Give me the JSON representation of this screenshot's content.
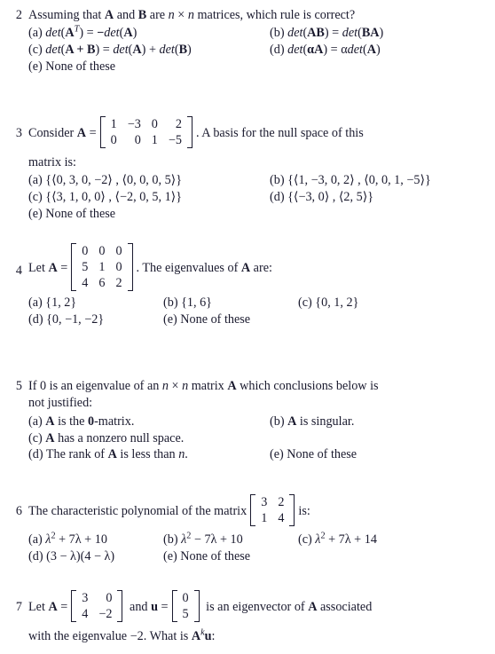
{
  "document": {
    "type": "linear-algebra-multiple-choice-exam",
    "background_color": "#ffffff",
    "text_color": "#1a1a2e"
  },
  "questions": [
    {
      "number": "2",
      "stem_parts": {
        "p1": "Assuming that ",
        "A": "A",
        "p2": " and ",
        "B": "B",
        "p3": " are ",
        "n1": "n",
        "times": " × ",
        "n2": "n",
        "p4": " matrices, which rule is correct?"
      },
      "options": {
        "a_label": "(a)",
        "a_det1": "det",
        "a_open": "(",
        "a_A": "A",
        "a_T": "T",
        "a_close": ")",
        "a_eq": " = ",
        "a_minus": "−",
        "a_det2": "det",
        "a_A2": "A",
        "b_label": "(b)",
        "b_det1": "det",
        "b_AB": "AB",
        "b_eq": " = ",
        "b_det2": "det",
        "b_BA": "BA",
        "c_label": "(c)",
        "c_det1": "det",
        "c_ApB": "A + B",
        "c_eq": " = ",
        "c_det2": "det",
        "c_A": "A",
        "c_plus": " + ",
        "c_det3": "det",
        "c_B": "B",
        "d_label": "(d)",
        "d_det1": "det",
        "d_alphaA": "αA",
        "d_eq": " = ",
        "d_alpha": "α",
        "d_det2": "det",
        "d_A": "A",
        "e_label": "(e)",
        "e_text": "None of these"
      }
    },
    {
      "number": "3",
      "stem_pre": "Consider ",
      "stem_A": "A",
      "stem_eq": " =",
      "matrix": {
        "rows": [
          [
            "1",
            "−3",
            "0",
            "2"
          ],
          [
            "0",
            "0",
            "1",
            "−5"
          ]
        ]
      },
      "stem_post": ". A basis for the null space of this",
      "stem_line2": "matrix is:",
      "options": {
        "a_label": "(a)",
        "a_text": "{⟨0, 3, 0, −2⟩ , ⟨0, 0, 0, 5⟩}",
        "b_label": "(b)",
        "b_text": "{⟨1, −3, 0, 2⟩ , ⟨0, 0, 1, −5⟩}",
        "c_label": "(c)",
        "c_text": "{⟨3, 1, 0, 0⟩ , ⟨−2, 0, 5, 1⟩}",
        "d_label": "(d)",
        "d_text": "{⟨−3, 0⟩ , ⟨2, 5⟩}",
        "e_label": "(e)",
        "e_text": "None of these"
      }
    },
    {
      "number": "4",
      "stem_pre": "Let ",
      "stem_A": "A",
      "stem_eq": " =",
      "matrix": {
        "rows": [
          [
            "0",
            "0",
            "0"
          ],
          [
            "5",
            "1",
            "0"
          ],
          [
            "4",
            "6",
            "2"
          ]
        ]
      },
      "stem_post_1": ". The eigenvalues of ",
      "stem_post_A": "A",
      "stem_post_2": " are:",
      "options": {
        "a_label": "(a)",
        "a_text": "{1, 2}",
        "b_label": "(b)",
        "b_text": "{1, 6}",
        "c_label": "(c)",
        "c_text": "{0, 1, 2}",
        "d_label": "(d)",
        "d_text": "{0, −1, −2}",
        "e_label": "(e)",
        "e_text": "None of these"
      }
    },
    {
      "number": "5",
      "stem_parts": {
        "p1": "If 0 is an eigenvalue of an ",
        "n1": "n",
        "times": " × ",
        "n2": "n",
        "p2": " matrix ",
        "A": "A",
        "p3": " which conclusions below is"
      },
      "stem_line2": "not justified:",
      "options": {
        "a_label": "(a)",
        "a_A": "A",
        "a_mid": " is the ",
        "a_zero": "0",
        "a_end": "-matrix.",
        "b_label": "(b)",
        "b_A": "A",
        "b_text": " is singular.",
        "c_label": "(c)",
        "c_A": "A",
        "c_text": " has a nonzero null space.",
        "d_label": "(d)",
        "d_pre": "The rank of ",
        "d_A": "A",
        "d_mid": " is less than ",
        "d_n": "n",
        "d_end": ".",
        "e_label": "(e)",
        "e_text": "None of these"
      }
    },
    {
      "number": "6",
      "stem_pre": "The characteristic polynomial of the matrix",
      "matrix": {
        "rows": [
          [
            "3",
            "2"
          ],
          [
            "1",
            "4"
          ]
        ]
      },
      "stem_post": "is:",
      "options": {
        "a_label": "(a)",
        "a_lam": "λ",
        "a_sup": "2",
        "a_text": " + 7λ + 10",
        "b_label": "(b)",
        "b_lam": "λ",
        "b_sup": "2",
        "b_text": " − 7λ + 10",
        "c_label": "(c)",
        "c_lam": "λ",
        "c_sup": "2",
        "c_text": " + 7λ + 14",
        "d_label": "(d)",
        "d_text": "(3 − λ)(4 − λ)",
        "e_label": "(e)",
        "e_text": "None of these"
      }
    },
    {
      "number": "7",
      "stem_pre": "Let ",
      "stem_A": "A",
      "stem_eq": " =",
      "matrix_a": {
        "rows": [
          [
            "3",
            "0"
          ],
          [
            "4",
            "−2"
          ]
        ]
      },
      "stem_mid_1": " and ",
      "stem_u": "u",
      "stem_mid_2": " =",
      "matrix_u": {
        "rows": [
          [
            "0"
          ],
          [
            "5"
          ]
        ]
      },
      "stem_post_1": " is an eigenvector of ",
      "stem_post_A": "A",
      "stem_post_2": " associated",
      "line2": {
        "p1": "with the eigenvalue −2. What is ",
        "A": "A",
        "k": "k",
        "u": "u",
        "p2": ":"
      }
    }
  ]
}
